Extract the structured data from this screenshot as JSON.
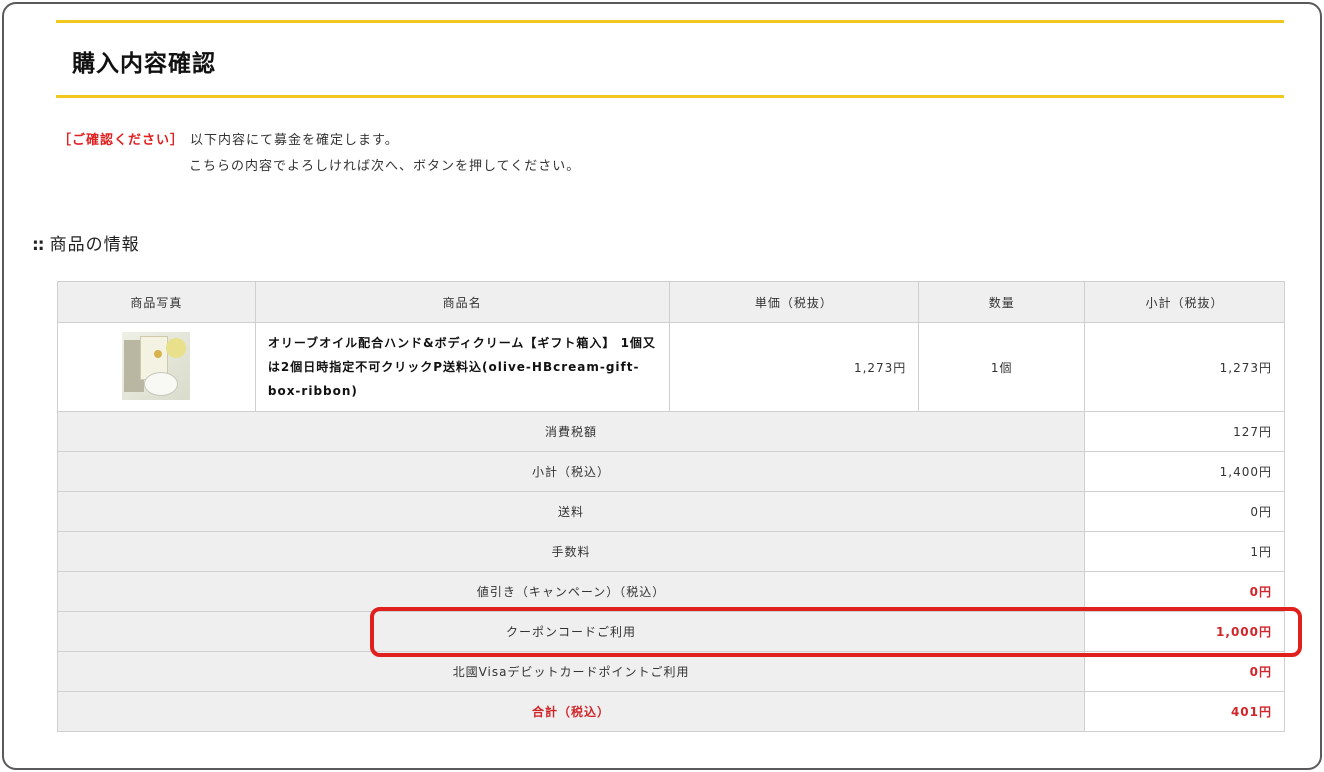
{
  "page_title": "購入内容確認",
  "confirm": {
    "tag": "［ご確認ください］",
    "line1": "以下内容にて募金を確定します。",
    "line2": "こちらの内容でよろしければ次へ、ボタンを押してください。"
  },
  "section": {
    "dots": "::",
    "title": "商品の情報"
  },
  "table": {
    "headers": [
      "商品写真",
      "商品名",
      "単価（税抜）",
      "数量",
      "小計（税抜）"
    ],
    "item": {
      "name": "オリーブオイル配合ハンド&ボディクリーム【ギフト箱入】 1個又は2個日時指定不可クリックP送料込(olive-HBcream-gift-box-ribbon)",
      "unit_price": "1,273円",
      "quantity": "1個",
      "subtotal": "1,273円"
    },
    "summary": [
      {
        "label": "消費税額",
        "value": "127円"
      },
      {
        "label": "小計（税込）",
        "value": "1,400円"
      },
      {
        "label": "送料",
        "value": "0円"
      },
      {
        "label": "手数料",
        "value": "1円"
      },
      {
        "label": "値引き（キャンペーン）（税込）",
        "value": "0円"
      },
      {
        "label": "クーポンコードご利用",
        "value": "1,000円"
      },
      {
        "label": "北國Visaデビットカードポイントご利用",
        "value": "0円"
      },
      {
        "label": "合計（税込）",
        "value": "401円"
      }
    ]
  },
  "colors": {
    "accent_yellow": "#f2c81e",
    "alert_red": "#e02020",
    "highlight_red": "#e0201c"
  }
}
